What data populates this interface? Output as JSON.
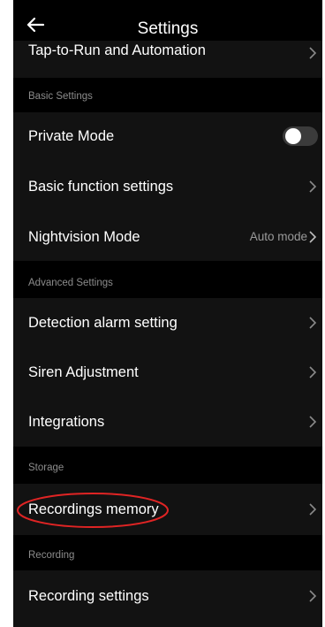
{
  "header": {
    "back_icon": "arrow-left-icon",
    "title": "Settings"
  },
  "rows": {
    "tap_to_run": "Tap-to-Run and Automation",
    "private_mode": "Private Mode",
    "basic_function": "Basic function settings",
    "nightvision": "Nightvision Mode",
    "nightvision_value": "Auto mode",
    "detection_alarm": "Detection alarm setting",
    "siren": "Siren Adjustment",
    "integrations": "Integrations",
    "recordings_memory": "Recordings memory",
    "recording_settings": "Recording settings"
  },
  "sections": {
    "basic": "Basic Settings",
    "advanced": "Advanced Settings",
    "storage": "Storage",
    "recording": "Recording"
  },
  "private_mode_enabled": false,
  "colors": {
    "background": "#000000",
    "row_background": "#121212",
    "text": "#ffffff",
    "section_text": "#8c8c8c",
    "highlight": "#e02424"
  }
}
